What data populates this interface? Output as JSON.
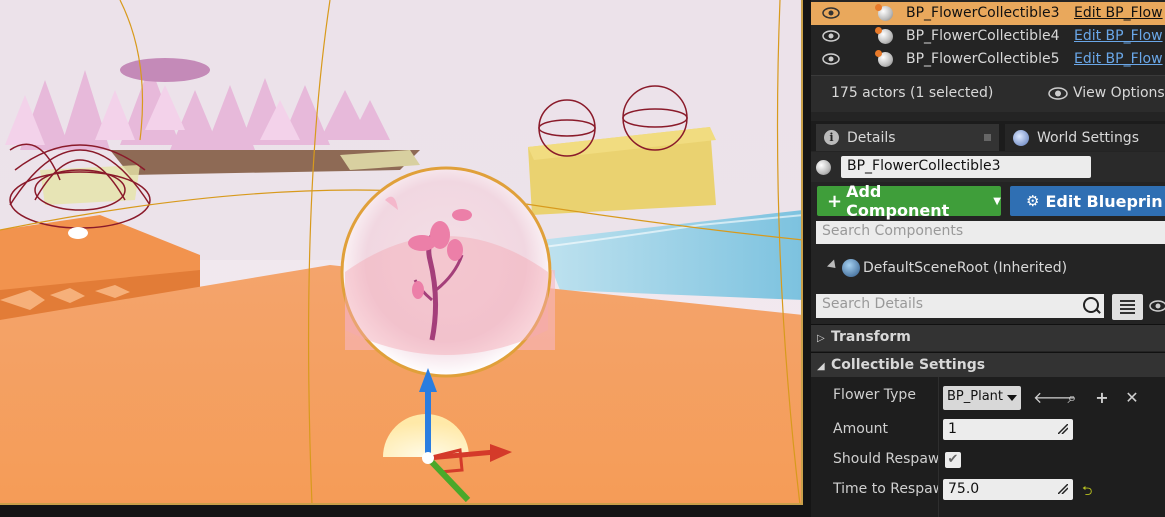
{
  "outliner": {
    "rows": [
      {
        "name": "BP_FlowerCollectible3",
        "edit": "Edit BP_Flow",
        "selected": true
      },
      {
        "name": "BP_FlowerCollectible4",
        "edit": "Edit BP_Flow",
        "selected": false
      },
      {
        "name": "BP_FlowerCollectible5",
        "edit": "Edit BP_Flow",
        "selected": false
      }
    ],
    "actor_count": "175 actors (1 selected)",
    "view_options": "View Options"
  },
  "tabs": {
    "details": "Details",
    "world_settings": "World Settings"
  },
  "details": {
    "actor_name": "BP_FlowerCollectible3",
    "add_component": "Add Component",
    "edit_blueprint": "Edit Blueprin",
    "search_components_placeholder": "Search Components",
    "root_component": "DefaultSceneRoot (Inherited)",
    "search_details_placeholder": "Search Details",
    "sections": {
      "transform": "Transform",
      "collectible_settings": "Collectible Settings"
    },
    "properties": {
      "flower_type": {
        "label": "Flower Type",
        "value": "BP_Plant"
      },
      "amount": {
        "label": "Amount",
        "value": "1"
      },
      "should_respawn": {
        "label": "Should Respawn",
        "checked": true
      },
      "time_to_respawn": {
        "label": "Time to Respawn",
        "value": "75.0"
      }
    }
  },
  "colors": {
    "selection": "#e9a85c",
    "add_component": "#3f9e3a",
    "edit_blueprint": "#2f6fb3",
    "viewport_border": "#c9a04a"
  },
  "icons": [
    "eye-icon",
    "actor-sphere-icon",
    "info-icon",
    "globe-icon",
    "plus-icon",
    "gear-icon",
    "search-icon",
    "grid-icon",
    "arrow-left-icon",
    "browse-icon",
    "add-icon",
    "clear-icon",
    "reset-icon"
  ]
}
